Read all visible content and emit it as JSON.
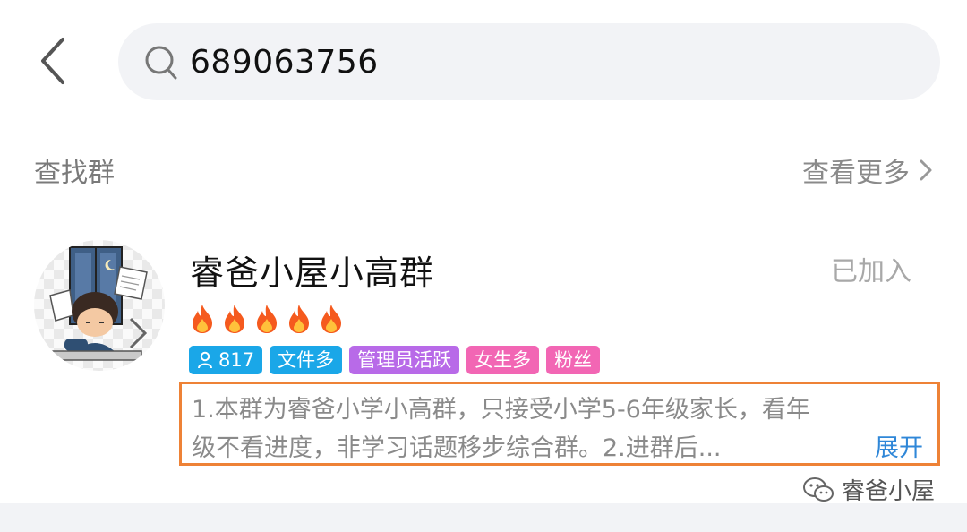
{
  "search": {
    "query": "689063756"
  },
  "section": {
    "title": "查找群",
    "see_more": "查看更多"
  },
  "group": {
    "name": "睿爸小屋小高群",
    "status": "已加入",
    "heat_level": 5,
    "tags": [
      {
        "label": "817",
        "color": "#1aa7e8",
        "icon": "person-icon"
      },
      {
        "label": "文件多",
        "color": "#1aa7e8"
      },
      {
        "label": "管理员活跃",
        "color": "#b86ae8"
      },
      {
        "label": "女生多",
        "color": "#f266b4"
      },
      {
        "label": "粉丝",
        "color": "#f266b4"
      }
    ],
    "description_line1": "1.本群为睿爸小学小高群，只接受小学5-6年级家长，看年",
    "description_line2": "级不看进度，非学习话题移步综合群。2.进群后...",
    "expand_label": "展开"
  },
  "watermark": {
    "text": "睿爸小屋"
  },
  "colors": {
    "highlight_border": "#ee8236",
    "link": "#2f87d8",
    "search_bg": "#f2f3f6"
  }
}
